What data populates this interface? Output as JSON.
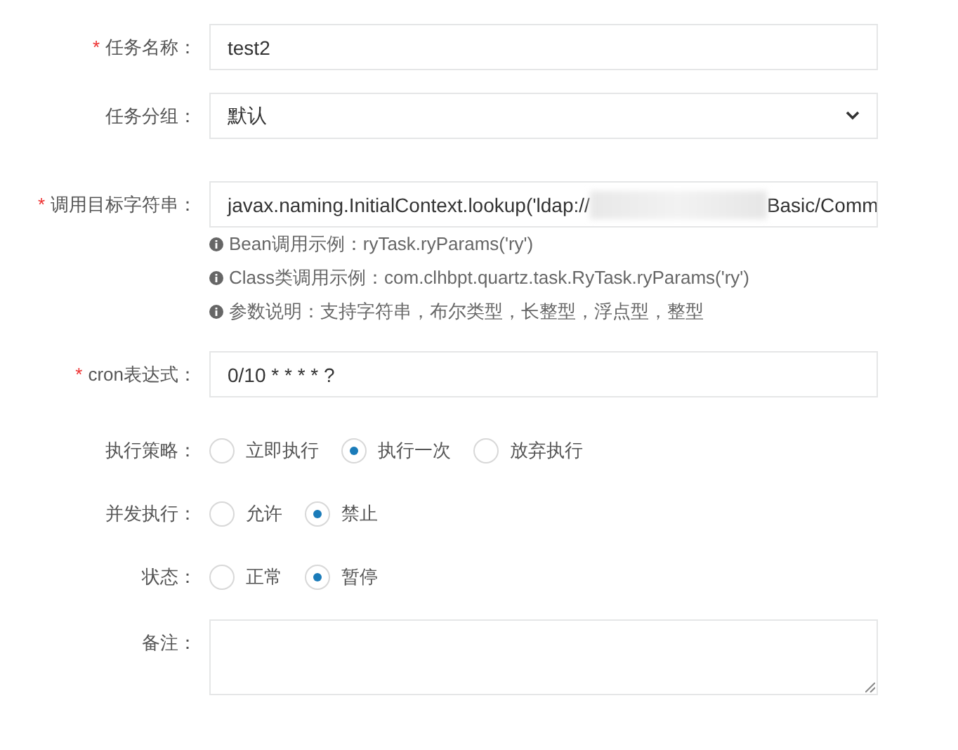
{
  "fields": [
    {
      "kind": "text",
      "label": "任务名称：",
      "required_mark": "*",
      "value": "test2"
    },
    {
      "kind": "select",
      "label": "任务分组：",
      "value": "默认"
    },
    {
      "kind": "target",
      "label": "调用目标字符串：",
      "required_mark": "*",
      "value_parts": [
        "javax.naming.InitialContext.lookup('ldap://",
        "Basic/Comm"
      ],
      "hints": [
        "Bean调用示例：ryTask.ryParams('ry')",
        "Class类调用示例：com.clhbpt.quartz.task.RyTask.ryParams('ry')",
        "参数说明：支持字符串，布尔类型，长整型，浮点型，整型"
      ]
    },
    {
      "kind": "text",
      "label": "cron表达式：",
      "required_mark": "*",
      "value": "0/10 * * * * ?"
    },
    {
      "kind": "radio",
      "label": "执行策略：",
      "options": [
        {
          "label": "立即执行",
          "selected": false
        },
        {
          "label": "执行一次",
          "selected": true
        },
        {
          "label": "放弃执行",
          "selected": false
        }
      ]
    },
    {
      "kind": "radio",
      "label": "并发执行：",
      "options": [
        {
          "label": "允许",
          "selected": false
        },
        {
          "label": "禁止",
          "selected": true
        }
      ]
    },
    {
      "kind": "radio",
      "label": "状态：",
      "options": [
        {
          "label": "正常",
          "selected": false
        },
        {
          "label": "暂停",
          "selected": true
        }
      ]
    },
    {
      "kind": "textarea",
      "label": "备注："
    }
  ]
}
